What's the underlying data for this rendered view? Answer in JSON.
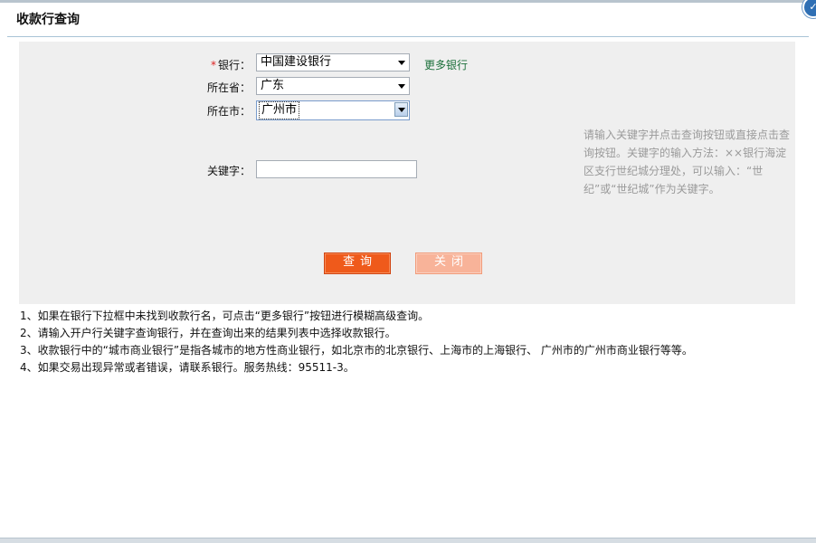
{
  "corner_button": {
    "glyph": "✓"
  },
  "page_title": "收款行查询",
  "form": {
    "required_mark": "*",
    "bank": {
      "label": "银行：",
      "value": "中国建设银行",
      "more_link": "更多银行"
    },
    "province": {
      "label": "所在省：",
      "value": "广东"
    },
    "city": {
      "label": "所在市：",
      "value": "广州市"
    },
    "keyword": {
      "label": "关键字：",
      "value": "",
      "placeholder": ""
    },
    "hint": "请输入关键字并点击查询按钮或直接点击查询按钮。关键字的输入方法：××银行海淀区支行世纪城分理处，可以输入：“世纪”或“世纪城”作为关键字。",
    "query_button": "查询",
    "close_button": "关闭"
  },
  "notes": [
    "1、如果在银行下拉框中未找到收款行名，可点击“更多银行”按钮进行模糊高级查询。",
    "2、请输入开户行关键字查询银行，并在查询出来的结果列表中选择收款银行。",
    "3、收款银行中的“城市商业银行”是指各城市的地方性商业银行，如北京市的北京银行、上海市的上海银行、 广州市的广州市商业银行等等。",
    "4、如果交易出现异常或者错误，请联系银行。服务热线：95511-3。"
  ],
  "colors": {
    "panel_bg": "#efefef",
    "query_button": "#ef5a1b",
    "close_button": "#f8b399",
    "link": "#1b6f3a",
    "hint_text": "#9a9a9a",
    "required": "#dd2222"
  }
}
